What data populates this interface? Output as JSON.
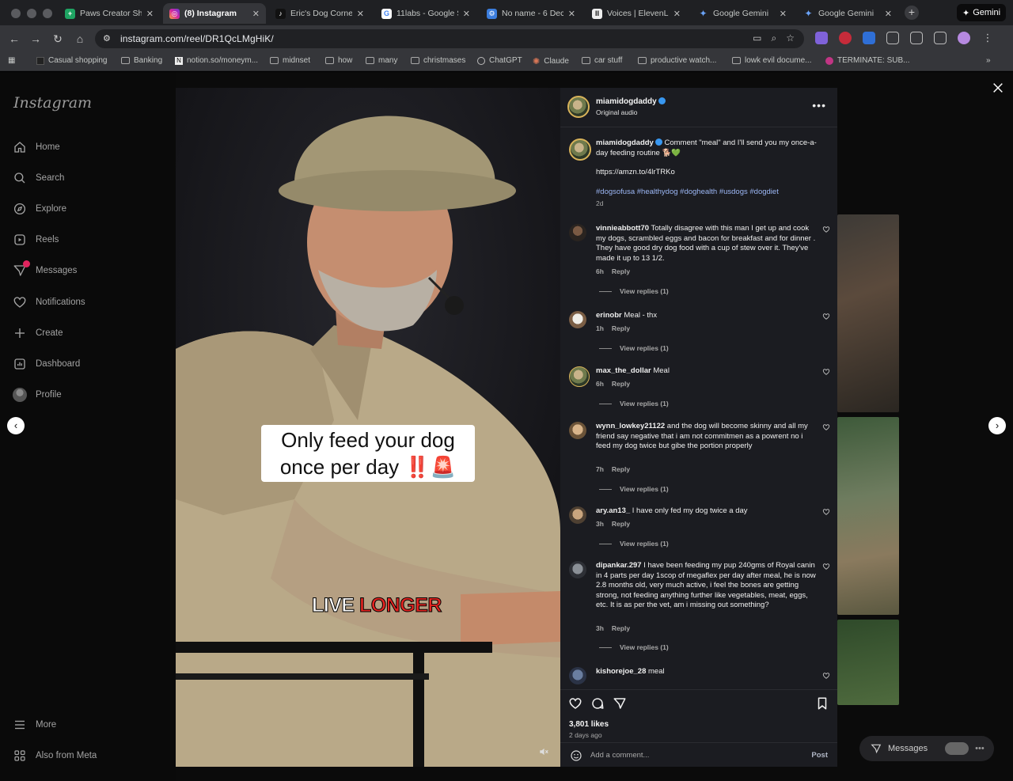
{
  "browser": {
    "tabs": [
      {
        "label": "Paws Creator Sh",
        "color": "#1fa463",
        "glyph": "+"
      },
      {
        "label": "(8) Instagram",
        "color": "#d6249f",
        "glyph": "◎",
        "active": true
      },
      {
        "label": "Eric's Dog Corne",
        "color": "#111111",
        "glyph": "♪"
      },
      {
        "label": "11labs - Google S",
        "color": "#ffffff",
        "glyph": "G"
      },
      {
        "label": "No name - 6 Dec",
        "color": "#3b7ddd",
        "glyph": "⚙"
      },
      {
        "label": "Voices | ElevenLa",
        "color": "#eeeeee",
        "glyph": "II"
      },
      {
        "label": "Google Gemini",
        "color": "#4a8cf0",
        "glyph": "✦"
      },
      {
        "label": "Google Gemini",
        "color": "#4a8cf0",
        "glyph": "✦"
      }
    ],
    "gemini_button": "Gemini",
    "url": "instagram.com/reel/DR1QcLMgHiK/",
    "bookmarks": [
      "Casual shopping",
      "Banking",
      "notion.so/moneym...",
      "midnset",
      "how",
      "many",
      "christmases",
      "ChatGPT",
      "Claude",
      "car stuff",
      "productive watch...",
      "lowk evil docume...",
      "TERMINATE: SUB..."
    ]
  },
  "instagram": {
    "logo": "Instagram",
    "nav": [
      "Home",
      "Search",
      "Explore",
      "Reels",
      "Messages",
      "Notifications",
      "Create",
      "Dashboard",
      "Profile"
    ],
    "nav_bottom": [
      "More",
      "Also from Meta"
    ],
    "video": {
      "caption_line1": "Only feed your dog",
      "caption_line2": "once per day",
      "caption_emoji": "‼️🚨",
      "overlay_word1": "LIVE",
      "overlay_word2": "LONGER"
    },
    "post": {
      "username": "miamidogdaddy",
      "audio": "Original audio",
      "caption_user": "miamidogdaddy",
      "caption_text": "Comment \"meal\" and I'll send you my once-a-day feeding routine 🐕💚",
      "link": "https://amzn.to/4lrTRKo",
      "hashtags": "#dogsofusa #healthydog #doghealth #usdogs #dogdiet",
      "caption_age": "2d"
    },
    "comments": [
      {
        "user": "vinnieabbott70",
        "text": "Totally disagree with this man I get up and cook my dogs, scrambled eggs and bacon for breakfast and for dinner . They have good dry dog food with a cup of stew over it. They've made it up to 13 1/2.",
        "age": "6h",
        "reply": "Reply",
        "view_replies": "View replies (1)"
      },
      {
        "user": "erinobr",
        "text": "Meal - thx",
        "age": "1h",
        "reply": "Reply",
        "view_replies": "View replies (1)"
      },
      {
        "user": "max_the_dollar",
        "text": "Meal",
        "age": "6h",
        "reply": "Reply",
        "view_replies": "View replies (1)"
      },
      {
        "user": "wynn_lowkey21122",
        "text": "and the dog will become skinny and all my friend say negative that i am not commitmen as a powrent no i feed my dog twice but gibe the portion properly",
        "age": "7h",
        "reply": "Reply",
        "view_replies": "View replies (1)"
      },
      {
        "user": "ary.an13_",
        "text": "I have only fed my dog twice a day",
        "age": "3h",
        "reply": "Reply",
        "view_replies": "View replies (1)"
      },
      {
        "user": "dipankar.297",
        "text": "I have been feeding my pup 240gms of Royal canin in 4 parts per day 1scop of megaflex per day after meal, he is now 2.8 months old, very much active, i feel the bones are getting strong, not feeding anything further like vegetables, meat, eggs, etc. It is as per the vet, am i missing out something?",
        "age": "3h",
        "reply": "Reply",
        "view_replies": "View replies (1)"
      },
      {
        "user": "kishorejoe_28",
        "text": "meal",
        "age": "",
        "reply": "",
        "view_replies": ""
      }
    ],
    "likes": "3,801 likes",
    "posted": "2 days ago",
    "add_comment_placeholder": "Add a comment...",
    "post_button": "Post",
    "messages_pill": "Messages"
  }
}
